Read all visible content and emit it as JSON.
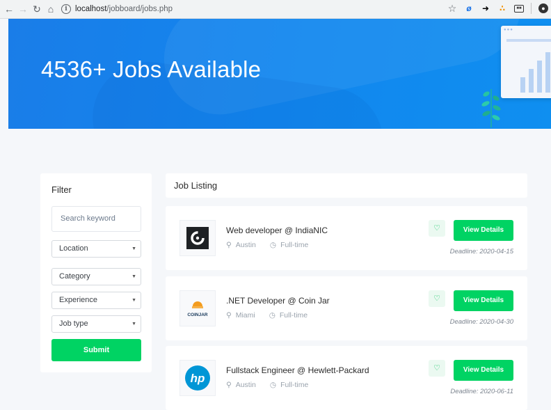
{
  "browser": {
    "back_icon": "arrow-left",
    "forward_icon": "arrow-right",
    "reload_icon": "reload",
    "home_icon": "home",
    "url_host": "localhost",
    "url_path": "/jobboard/jobs.php"
  },
  "hero": {
    "title": "4536+ Jobs Available"
  },
  "filter": {
    "title": "Filter",
    "search_placeholder": "Search keyword",
    "selects": [
      {
        "label": "Location"
      },
      {
        "label": "Category"
      },
      {
        "label": "Experience"
      },
      {
        "label": "Job type"
      }
    ],
    "submit_label": "Submit"
  },
  "listing": {
    "title": "Job Listing",
    "jobs": [
      {
        "title": "Web developer @ IndiaNIC",
        "location": "Austin",
        "type": "Full-time",
        "deadline": "Deadline: 2020-04-15",
        "view_label": "View Details",
        "logo": "indianic-logo"
      },
      {
        "title": ".NET Developer @ Coin Jar",
        "location": "Miami",
        "type": "Full-time",
        "deadline": "Deadline: 2020-04-30",
        "view_label": "View Details",
        "logo": "coinjar-logo",
        "logo_text": "COINJAR"
      },
      {
        "title": "Fullstack Engineer @ Hewlett-Packard",
        "location": "Austin",
        "type": "Full-time",
        "deadline": "Deadline: 2020-06-11",
        "view_label": "View Details",
        "logo": "hp-logo",
        "logo_text": "hp"
      }
    ]
  },
  "colors": {
    "hero_blue": "#1286ee",
    "accent_green": "#00d363"
  }
}
